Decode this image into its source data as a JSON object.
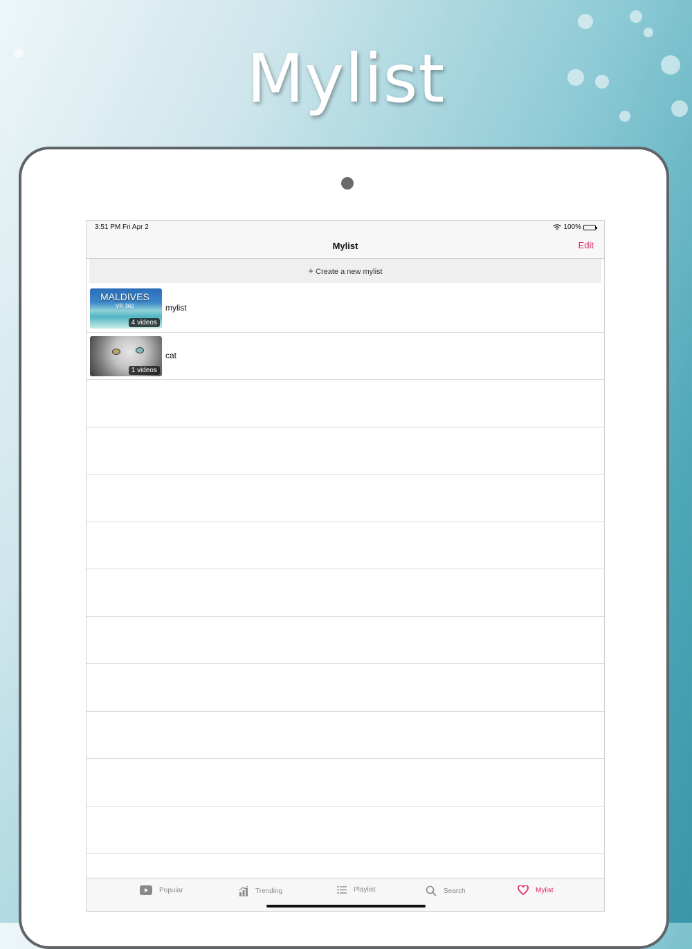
{
  "promo": {
    "title": "Mylist"
  },
  "status_bar": {
    "time": "3:51 PM   Fri Apr 2",
    "battery": "100%"
  },
  "nav": {
    "title": "Mylist",
    "edit_label": "Edit"
  },
  "create": {
    "plus": "+",
    "label": "Create a new mylist"
  },
  "mylists": [
    {
      "name": "mylist",
      "count": "4 videos",
      "thumb_text": "MALDIVES",
      "thumb_sub": "VR 360"
    },
    {
      "name": "cat",
      "count": "1 videos"
    }
  ],
  "tabs": [
    {
      "label": "Popular",
      "icon": "play-icon"
    },
    {
      "label": "Trending",
      "icon": "trending-icon"
    },
    {
      "label": "Playlist",
      "icon": "list-icon"
    },
    {
      "label": "Search",
      "icon": "search-icon"
    },
    {
      "label": "Mylist",
      "icon": "heart-icon",
      "active": true
    }
  ],
  "colors": {
    "accent": "#e0245e",
    "inactive": "#8a8a8a"
  }
}
